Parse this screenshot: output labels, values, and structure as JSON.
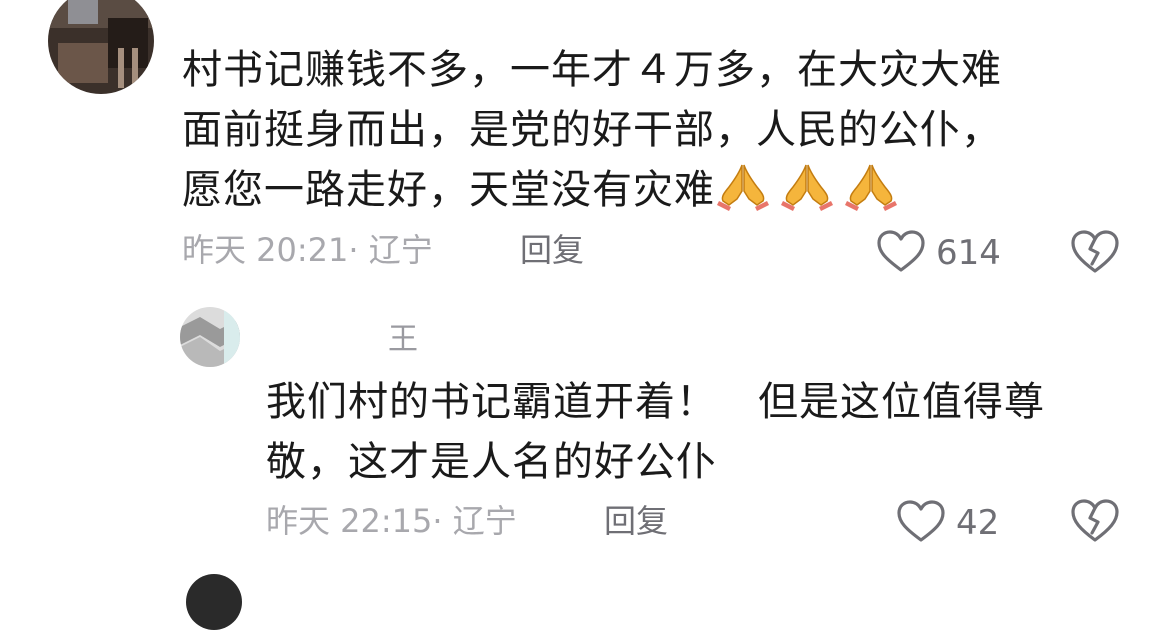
{
  "comments": [
    {
      "text_lines": [
        "村书记赚钱不多，一年才４万多，在大灾大难",
        "面前挺身而出，是党的好干部，人民的公仆，",
        "愿您一路走好，天堂没有灾难"
      ],
      "emoji": [
        "folded-hands",
        "folded-hands",
        "folded-hands"
      ],
      "meta": "昨天 20:21· 辽宁",
      "reply_label": "回复",
      "likes": "614"
    },
    {
      "username": "王",
      "text_lines": [
        "我们村的书记霸道开着！　但是这位值得尊",
        "敬，这才是人名的好公仆"
      ],
      "meta": "昨天 22:15· 辽宁",
      "reply_label": "回复",
      "likes": "42"
    }
  ],
  "colors": {
    "text": "#1a1a1a",
    "meta": "#a8a8ad",
    "icon": "#6f6f75"
  },
  "icons": [
    "heart-outline-icon",
    "broken-heart-icon",
    "folded-hands-emoji"
  ]
}
